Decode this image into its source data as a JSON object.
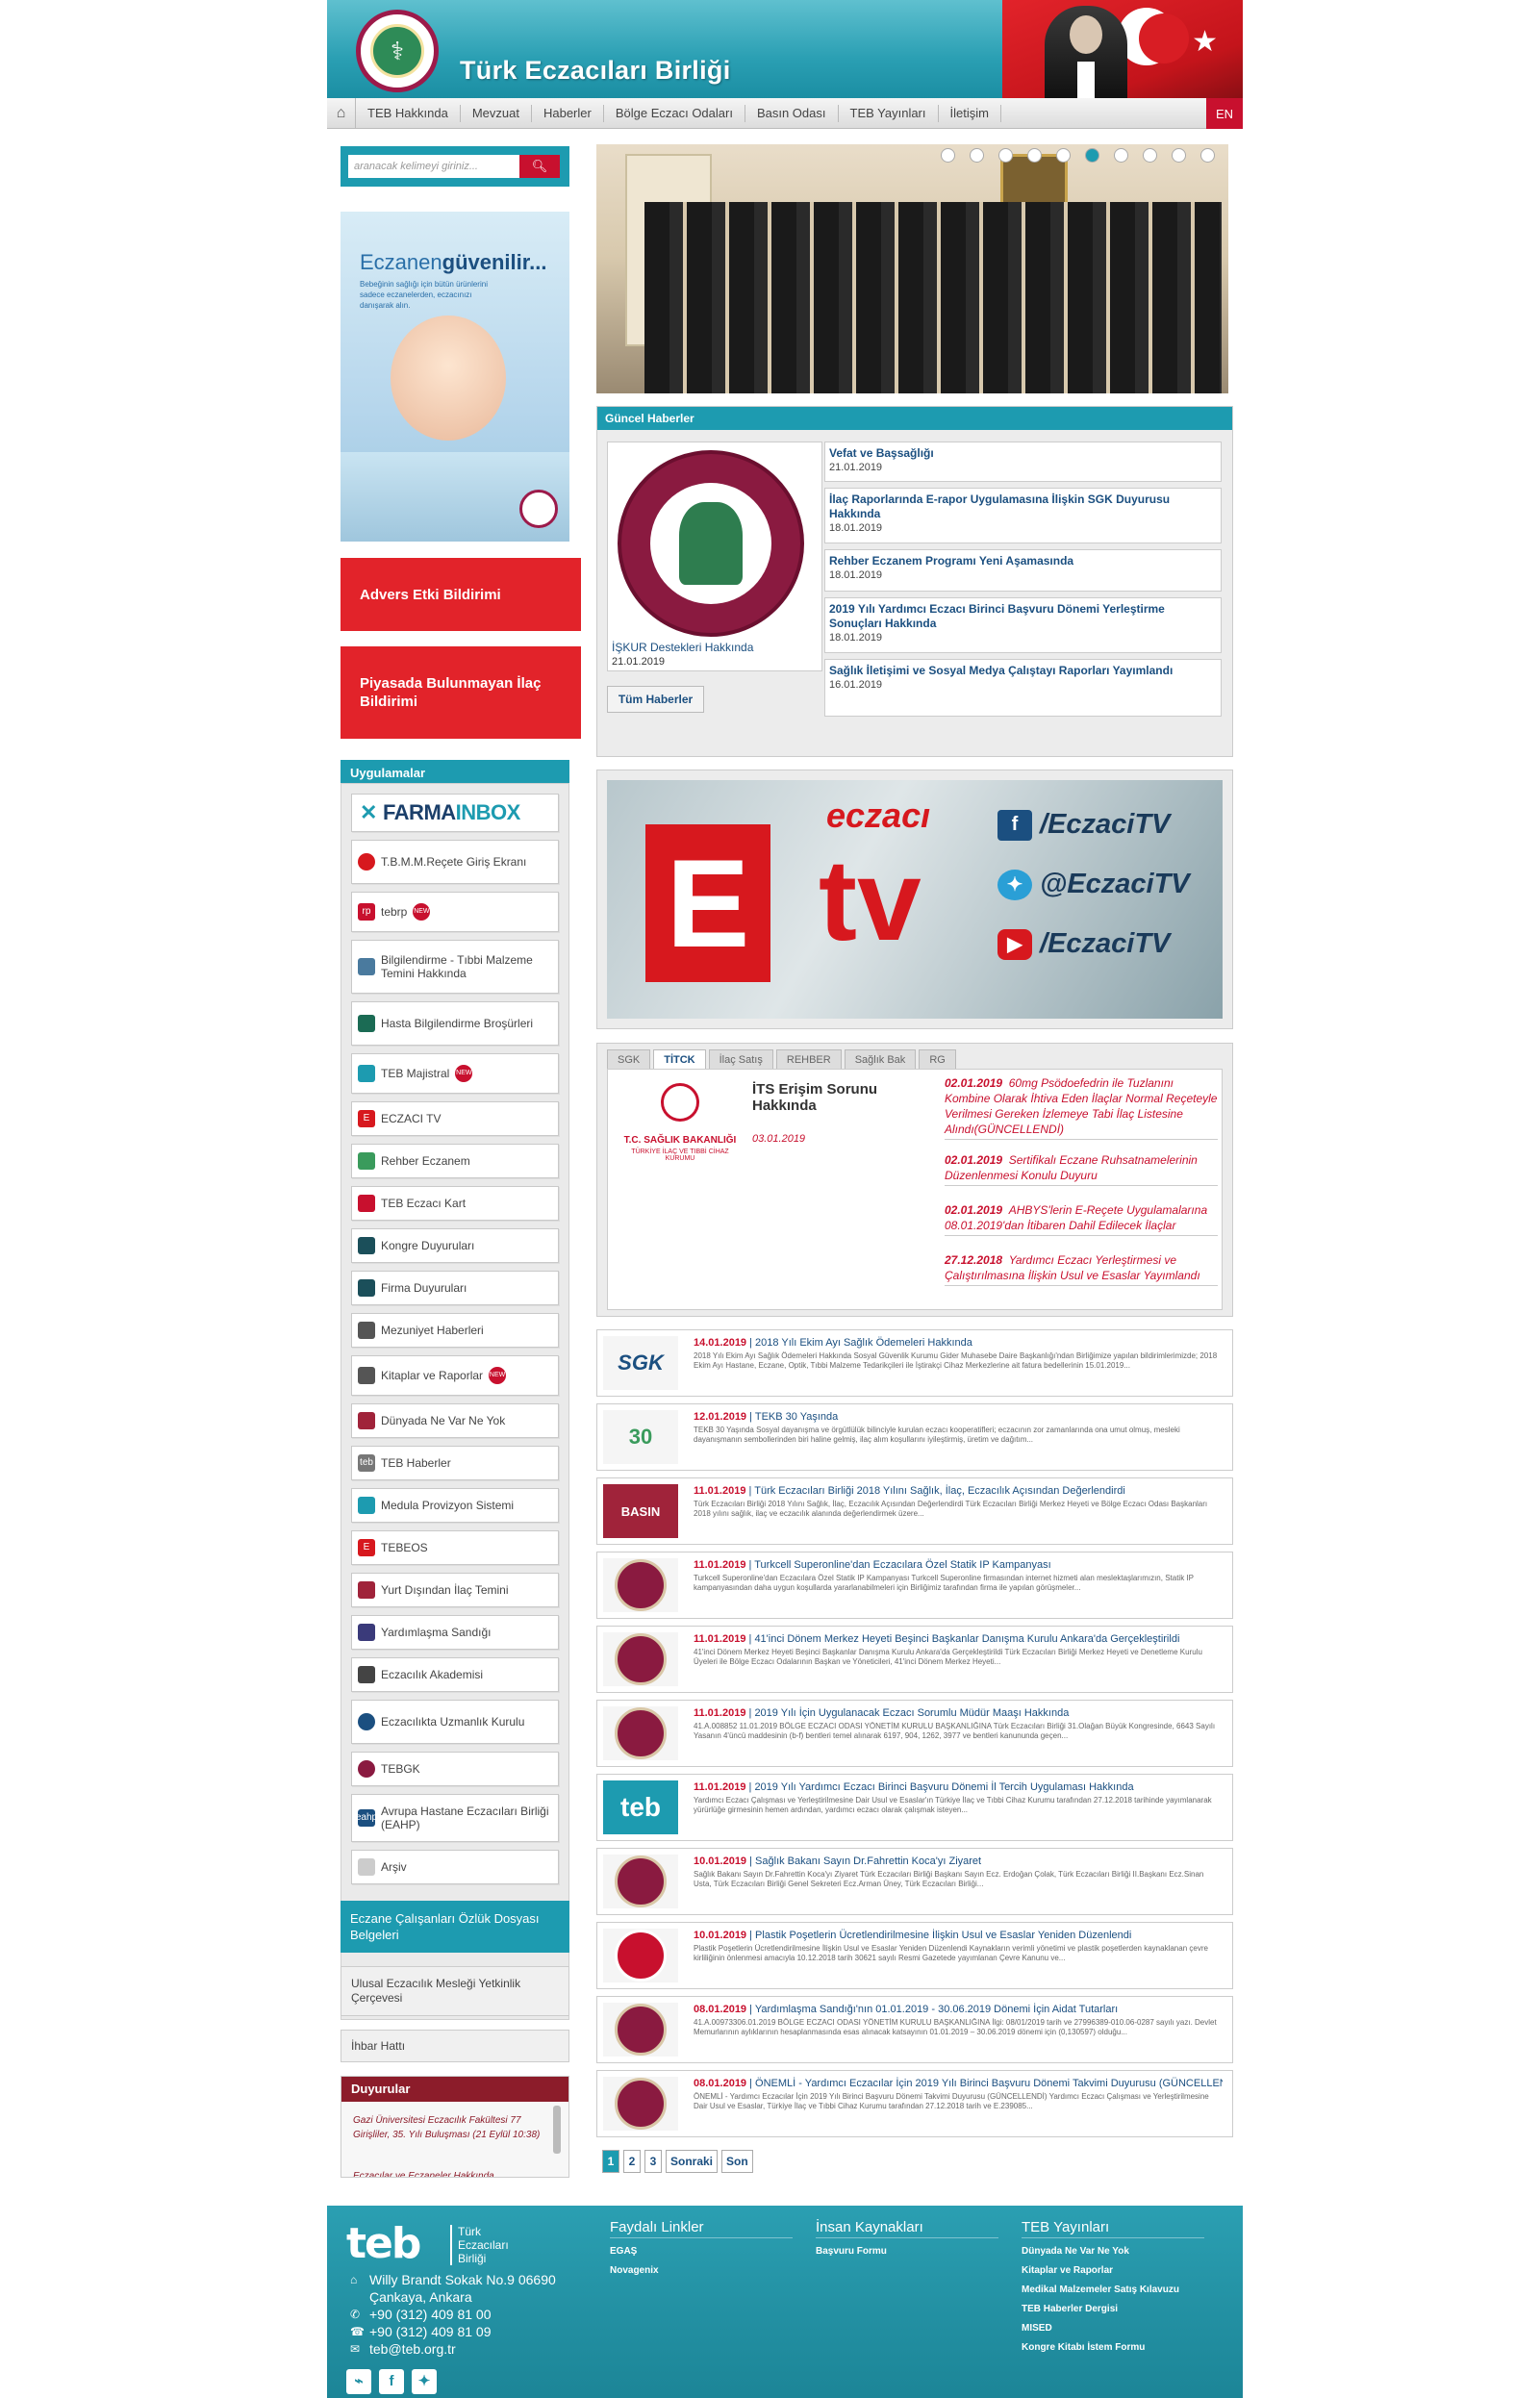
{
  "header": {
    "title": "Türk Eczacıları Birliği",
    "nav": [
      "TEB Hakkında",
      "Mevzuat",
      "Haberler",
      "Bölge Eczacı Odaları",
      "Basın Odası",
      "TEB Yayınları",
      "İletişim"
    ],
    "lang": "EN"
  },
  "search": {
    "placeholder": "aranacak kelimeyi giriniz...",
    "button_icon": "search-icon"
  },
  "banner": {
    "headline_a": "Eczanen",
    "headline_b": "güvenilir...",
    "sub": "Bebeğinin sağlığı için bütün ürünlerini sadece eczanelerden, eczacınızı danışarak alın."
  },
  "left": {
    "adverse": "Advers Etki Bildirimi",
    "missing_drug": "Piyasada Bulunmayan İlaç Bildirimi",
    "apps_title": "Uygulamalar",
    "farma_a": "FARMA",
    "farma_b": "INBOX",
    "apps": [
      "T.B.M.M.Reçete Giriş Ekranı",
      "tebrp",
      "Bilgilendirme - Tıbbi Malzeme Temini Hakkında",
      "Hasta Bilgilendirme Broşürleri",
      "TEB Majistral",
      "ECZACI TV",
      "Rehber Eczanem",
      "TEB Eczacı Kart",
      "Kongre Duyuruları",
      "Firma Duyuruları",
      "Mezuniyet Haberleri",
      "Kitaplar ve Raporlar",
      "Dünyada Ne Var Ne Yok",
      "TEB Haberler",
      "Medula Provizyon Sistemi",
      "TEBEOS",
      "Yurt Dışından İlaç Temini",
      "Yardımlaşma Sandığı",
      "Eczacılık Akademisi",
      "Eczacılıkta Uzmanlık Kurulu",
      "TEBGK",
      "Avrupa Hastane Eczacıları Birliği (EAHP)",
      "Arşiv"
    ],
    "ozluk": "Eczane Çalışanları Özlük Dosyası Belgeleri",
    "yetkinlik": "Ulusal Eczacılık Mesleği Yetkinlik Çerçevesi",
    "ihbar": "İhbar Hattı",
    "duyurular_title": "Duyurular",
    "duyurular_text": "Gazi Üniversitesi Eczacılık Fakültesi 77 Girişliler, 35. Yılı Buluşması (21 Eylül 10:38)",
    "duyurular_text2": "Eczacılar ve Eczaneler Hakkında"
  },
  "guncel": {
    "title": "Güncel Haberler",
    "featured_title": "İŞKUR Destekleri Hakkında",
    "featured_date": "21.01.2019",
    "items": [
      {
        "title": "Vefat ve Başsağlığı",
        "date": "21.01.2019"
      },
      {
        "title": "İlaç Raporlarında E-rapor Uygulamasına İlişkin SGK Duyurusu Hakkında",
        "date": "18.01.2019"
      },
      {
        "title": "Rehber Eczanem Programı Yeni Aşamasında",
        "date": "18.01.2019"
      },
      {
        "title": "2019 Yılı Yardımcı Eczacı Birinci Başvuru Dönemi Yerleştirme Sonuçları Hakkında",
        "date": "18.01.2019"
      },
      {
        "title": "Sağlık İletişimi ve Sosyal Medya Çalıştayı Raporları Yayımlandı",
        "date": "16.01.2019"
      }
    ],
    "all": "Tüm Haberler"
  },
  "eczacitv": {
    "word": "eczacı",
    "tv": "tv",
    "letter": "E",
    "handles": [
      "/EczaciTV",
      "@EczaciTV",
      "/EczaciTV"
    ]
  },
  "tabs": {
    "labels": [
      "SGK",
      "TİTCK",
      "İlaç Satış",
      "REHBER",
      "Sağlık Bak",
      "RG"
    ],
    "logo_title": "T.C. SAĞLIK BAKANLIĞI",
    "logo_sub": "TÜRKİYE İLAÇ VE TIBBİ CİHAZ KURUMU",
    "main_title": "İTS Erişim Sorunu Hakkında",
    "main_date": "03.01.2019",
    "items": [
      {
        "date": "02.01.2019",
        "text": "60mg Psödoefedrin ile Tuzlanını Kombine Olarak İhtiva Eden İlaçlar Normal Reçeteyle Verilmesi Gereken İzlemeye Tabi İlaç Listesine Alındı(GÜNCELLENDİ)"
      },
      {
        "date": "02.01.2019",
        "text": "Sertifikalı Eczane Ruhsatnamelerinin Düzenlenmesi Konulu Duyuru"
      },
      {
        "date": "02.01.2019",
        "text": "AHBYS'lerin E-Reçete Uygulamalarına 08.01.2019'dan İtibaren Dahil Edilecek İlaçlar"
      },
      {
        "date": "27.12.2018",
        "text": "Yardımcı Eczacı Yerleştirmesi ve Çalıştırılmasına İlişkin Usul ve Esaslar Yayımlandı"
      }
    ]
  },
  "feed": [
    {
      "date": "14.01.2019",
      "title": "2018 Yılı Ekim Ayı Sağlık Ödemeleri Hakkında",
      "text": "2018 Yılı Ekim Ayı Sağlık Ödemeleri Hakkında Sosyal Güvenlik Kurumu Gider Muhasebe Daire Başkanlığı'ndan Birliğimize yapılan bildirimlerimizde; 2018 Ekim Ayı Hastane, Eczane, Optik, Tıbbi Malzeme Tedarikçileri ile İştirakçi Cihaz Merkezlerine ait fatura bedellerinin 15.01.2019...",
      "thumb": "SGK"
    },
    {
      "date": "12.01.2019",
      "title": "TEKB 30 Yaşında",
      "text": "TEKB 30 Yaşında Sosyal dayanışma ve örgütlülük bilinciyle kurulan eczacı kooperatifleri; eczacının zor zamanlarında ona umut olmuş, mesleki dayanışmanın sembollerinden biri haline gelmiş, ilaç alım koşullarını iyileştirmiş, üretim ve dağıtım...",
      "thumb": "30"
    },
    {
      "date": "11.01.2019",
      "title": "Türk Eczacıları Birliği 2018 Yılını Sağlık, İlaç, Eczacılık Açısından Değerlendirdi",
      "text": "Türk Eczacıları Birliği 2018 Yılını Sağlık, İlaç, Eczacılık Açısından Değerlendirdi Türk Eczacıları Birliği Merkez Heyeti ve Bölge Eczacı Odası Başkanları 2018 yılını sağlık, ilaç ve eczacılık alanında değerlendirmek üzere...",
      "thumb": "BASIN"
    },
    {
      "date": "11.01.2019",
      "title": "Turkcell Superonline'dan Eczacılara Özel Statik IP Kampanyası",
      "text": "Turkcell Superonline'dan Eczacılara Özel Statik IP Kampanyası Turkcell Superonline firmasından internet hizmeti alan meslektaşlarımızın, Statik IP kampanyasından daha uygun koşullarda yararlanabilmeleri için Birliğimiz tarafından firma ile yapılan görüşmeler...",
      "thumb": "seal"
    },
    {
      "date": "11.01.2019",
      "title": "41'inci Dönem Merkez Heyeti Beşinci Başkanlar Danışma Kurulu Ankara'da Gerçekleştirildi",
      "text": "41'inci Dönem Merkez Heyeti Beşinci Başkanlar Danışma Kurulu Ankara'da Gerçekleştirildi Türk Eczacıları Birliği Merkez Heyeti ve Denetleme Kurulu Üyeleri ile Bölge Eczacı Odalarının Başkan ve Yöneticileri, 41'inci Dönem Merkez Heyeti...",
      "thumb": "seal"
    },
    {
      "date": "11.01.2019",
      "title": "2019 Yılı İçin Uygulanacak Eczacı Sorumlu Müdür Maaşı Hakkında",
      "text": "41.A.008852 11.01.2019 BÖLGE ECZACI ODASI YÖNETİM KURULU BAŞKANLIĞINA Türk Eczacıları Birliği 31.Olağan Büyük Kongresinde, 6643 Sayılı Yasanın 4'üncü maddesinin (b-f) bentleri temel alınarak 6197, 904, 1262, 3977 ve bentleri kanununda geçen...",
      "thumb": "seal"
    },
    {
      "date": "11.01.2019",
      "title": "2019 Yılı Yardımcı Eczacı Birinci Başvuru Dönemi İl Tercih Uygulaması Hakkında",
      "text": "Yardımcı Eczacı Çalışması ve Yerleştirilmesine Dair Usul ve Esaslar'ın Türkiye İlaç ve Tıbbi Cihaz Kurumu tarafından 27.12.2018 tarihinde yayımlanarak yürürlüğe girmesinin hemen ardından, yardımcı eczacı olarak çalışmak isteyen...",
      "thumb": "teb"
    },
    {
      "date": "10.01.2019",
      "title": "Sağlık Bakanı Sayın Dr.Fahrettin Koca'yı Ziyaret",
      "text": "Sağlık Bakanı Sayın Dr.Fahrettin Koca'yı Ziyaret Türk Eczacıları Birliği Başkanı Sayın Ecz. Erdoğan Çolak, Türk Eczacıları Birliği II.Başkanı Ecz.Sinan Usta, Türk Eczacıları Birliği Genel Sekreteri Ecz.Arman Üney, Türk Eczacıları Birliği...",
      "thumb": "seal"
    },
    {
      "date": "10.01.2019",
      "title": "Plastik Poşetlerin Ücretlendirilmesine İlişkin Usul ve Esaslar Yeniden Düzenlendi",
      "text": "Plastik Poşetlerin Ücretlendirilmesine İlişkin Usul ve Esaslar Yeniden Düzenlendi Kaynakların verimli yönetimi ve plastik poşetlerden kaynaklanan çevre kirliliğinin önlenmesi amacıyla 10.12.2018 tarih 30621 sayılı Resmi Gazetede yayımlanan Çevre Kanunu ve...",
      "thumb": "rg"
    },
    {
      "date": "08.01.2019",
      "title": "Yardımlaşma Sandığı'nın 01.01.2019 - 30.06.2019 Dönemi İçin Aidat Tutarları",
      "text": "41.A.00973306.01.2019 BÖLGE ECZACI ODASI YÖNETİM KURULU BAŞKANLIĞINA İlgi: 08/01/2019 tarih ve 27996389-010.06-0287 sayılı yazı. Devlet Memurlarının aylıklarının hesaplanmasında esas alınacak katsayının 01.01.2019 – 30.06.2019 dönemi için (0,130597) olduğu...",
      "thumb": "seal"
    },
    {
      "date": "08.01.2019",
      "title": "ÖNEMLİ - Yardımcı Eczacılar İçin 2019 Yılı Birinci Başvuru Dönemi Takvimi Duyurusu (GÜNCELLENDİ)",
      "text": "ÖNEMLİ - Yardımcı Eczacılar İçin 2019 Yılı Birinci Başvuru Dönemi Takvimi Duyurusu (GÜNCELLENDİ) Yardımcı Eczacı Çalışması ve Yerleştirilmesine Dair Usul ve Esaslar, Türkiye İlaç ve Tıbbi Cihaz Kurumu tarafından 27.12.2018 tarih ve E.239085...",
      "thumb": "seal"
    }
  ],
  "pager": [
    "1",
    "2",
    "3",
    "Sonraki",
    "Son"
  ],
  "footer": {
    "logo": "teb",
    "logo_sub": "Türk Eczacıları Birliği",
    "address1": "Willy Brandt Sokak No.9 06690",
    "address2": "Çankaya, Ankara",
    "phone": "+90 (312) 409 81 00",
    "fax": "+90 (312) 409 81 09",
    "email": "teb@teb.org.tr",
    "col1_title": "Faydalı Linkler",
    "col1": [
      "EGAŞ",
      "Novagenix"
    ],
    "col2_title": "İnsan Kaynakları",
    "col2": [
      "Başvuru Formu"
    ],
    "col3_title": "TEB Yayınları",
    "col3": [
      "Dünyada Ne Var Ne Yok",
      "Kitaplar ve Raporlar",
      "Medikal Malzemeler Satış Kılavuzu",
      "TEB Haberler Dergisi",
      "MISED",
      "Kongre Kitabı İstem Formu"
    ]
  }
}
